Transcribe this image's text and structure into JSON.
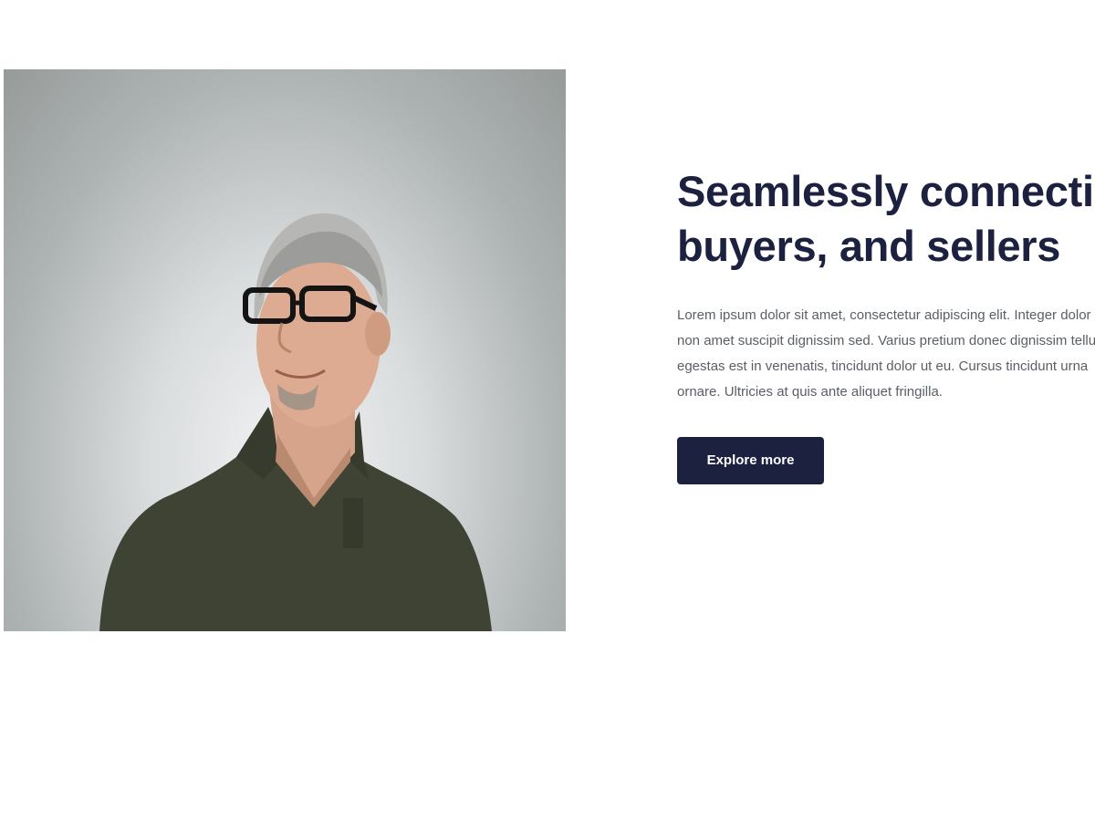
{
  "hero": {
    "headline_line1": "Seamlessly connecting",
    "headline_line2": "buyers, and sellers",
    "body_lines": [
      "Lorem ipsum dolor sit amet, consectetur adipiscing elit. Integer dolor",
      "non amet suscipit dignissim sed. Varius pretium donec dignissim tellus",
      "egestas est in venenatis, tincidunt dolor ut eu. Cursus tincidunt urna",
      "ornare. Ultricies at quis ante aliquet fringilla."
    ],
    "cta_label": "Explore more",
    "photo_subject": "portrait of a smiling man with glasses wearing an olive polo shirt"
  },
  "colors": {
    "headline": "#1d2140",
    "body_text": "#5a5f66",
    "button_bg": "#1d2140",
    "button_text": "#ffffff",
    "background": "#ffffff"
  }
}
